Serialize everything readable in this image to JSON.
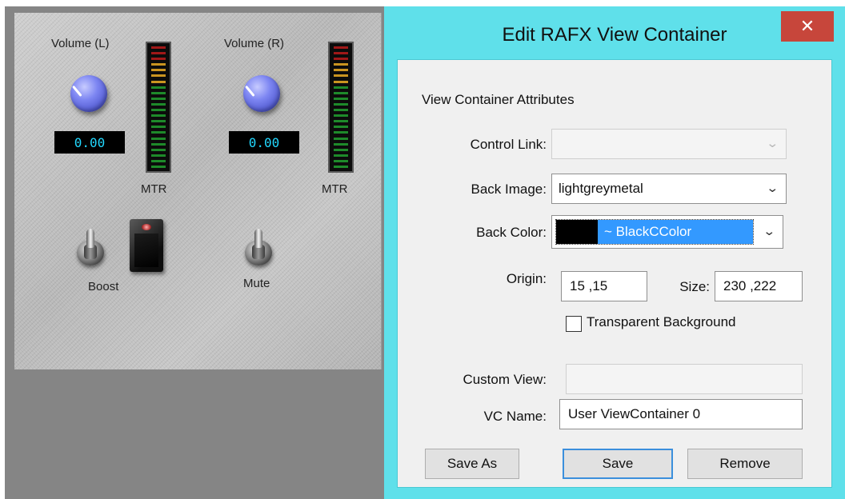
{
  "plugin": {
    "volume_l_label": "Volume (L)",
    "volume_r_label": "Volume (R)",
    "volume_l_value": "0.00",
    "volume_r_value": "0.00",
    "meter_l_label": "MTR",
    "meter_r_label": "MTR",
    "boost_label": "Boost",
    "mute_label": "Mute"
  },
  "dialog": {
    "title": "Edit RAFX View Container",
    "close_glyph": "✕",
    "section_title": "View Container Attributes",
    "control_link_label": "Control Link:",
    "control_link_value": "",
    "back_image_label": "Back Image:",
    "back_image_value": "lightgreymetal",
    "back_color_label": "Back Color:",
    "back_color_value": "~ BlackCColor",
    "back_color_swatch": "#000000",
    "selection_color": "#3399ff",
    "origin_label": "Origin:",
    "origin_value": "15 ,15",
    "size_label": "Size:",
    "size_value": "230 ,222",
    "transparent_label": "Transparent Background",
    "transparent_checked": false,
    "custom_view_label": "Custom View:",
    "custom_view_value": "",
    "vc_name_label": "VC Name:",
    "vc_name_value": "User ViewContainer 0",
    "save_as_label": "Save As",
    "save_label": "Save",
    "remove_label": "Remove"
  },
  "colors": {
    "workspace": "#858585",
    "dialog_frame": "#5fe0ea",
    "close_button": "#c7463b",
    "display_text": "#22d8ff",
    "knob": "#6b75e8"
  },
  "icons": {
    "dropdown": "chevron-down-icon",
    "close": "close-icon"
  }
}
